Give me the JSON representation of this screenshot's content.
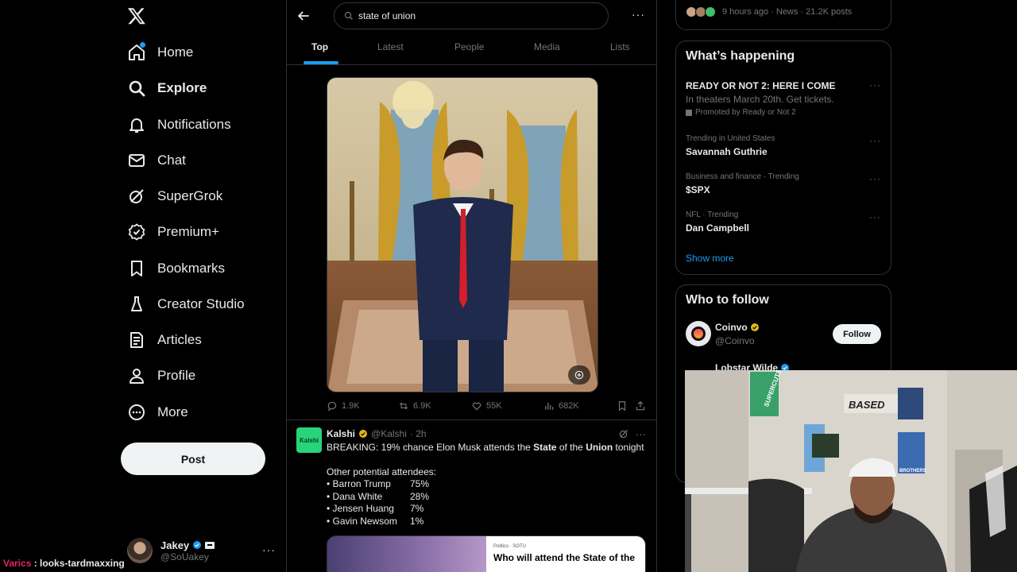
{
  "nav": {
    "items": [
      {
        "label": "Home",
        "icon": "home-icon"
      },
      {
        "label": "Explore",
        "icon": "search-icon"
      },
      {
        "label": "Notifications",
        "icon": "bell-icon"
      },
      {
        "label": "Chat",
        "icon": "mail-icon"
      },
      {
        "label": "SuperGrok",
        "icon": "grok-icon"
      },
      {
        "label": "Premium+",
        "icon": "premium-icon"
      },
      {
        "label": "Bookmarks",
        "icon": "bookmark-icon"
      },
      {
        "label": "Creator Studio",
        "icon": "creator-icon"
      },
      {
        "label": "Articles",
        "icon": "articles-icon"
      },
      {
        "label": "Profile",
        "icon": "profile-icon"
      },
      {
        "label": "More",
        "icon": "more-circle-icon"
      }
    ],
    "post_label": "Post"
  },
  "account": {
    "name": "Jakey",
    "handle": "@SoUakey",
    "more": "···"
  },
  "overlay_chat": {
    "user": "Varics",
    "separator": " : ",
    "message": "looks-tardmaxxing"
  },
  "search": {
    "query": "state of union",
    "more": "···"
  },
  "tabs": [
    "Top",
    "Latest",
    "People",
    "Media",
    "Lists"
  ],
  "tweet1": {
    "replies": "1.9K",
    "reposts": "6.9K",
    "likes": "55K",
    "views": "682K"
  },
  "tweet2": {
    "avatar_text": "Kalshi",
    "name": "Kalshi",
    "handle": "@Kalshi",
    "time": "· 2h",
    "line1_pre": "BREAKING: 19% chance Elon Musk attends the ",
    "line1_b1": "State",
    "line1_mid1": " of the ",
    "line1_b2": "Union",
    "line1_post": " tonight",
    "subhead": "Other potential attendees:",
    "attendees": [
      {
        "name": "• Barron Trump",
        "pct": "75%"
      },
      {
        "name": "• Dana White",
        "pct": "28%"
      },
      {
        "name": "• Jensen Huang",
        "pct": "7%"
      },
      {
        "name": "• Gavin Newsom",
        "pct": "1%"
      }
    ],
    "card_tag": "Politics · SOTU",
    "card_title": "Who will attend the State of the"
  },
  "right": {
    "news_meta": "9 hours ago · News · 21.2K posts",
    "happening_title": "What’s happening",
    "promo": {
      "title": "READY OR NOT 2: HERE I COME",
      "sub": "In theaters March 20th. Get tickets.",
      "tag": "Promoted by Ready or Not 2"
    },
    "trends": [
      {
        "context": "Trending in United States",
        "name": "Savannah Guthrie"
      },
      {
        "context": "Business and finance · Trending",
        "name": "$SPX"
      },
      {
        "context": "NFL · Trending",
        "name": "Dan Campbell"
      }
    ],
    "show_more": "Show more",
    "who_title": "Who to follow",
    "follow": [
      {
        "name": "Coinvo",
        "handle": "@Coinvo",
        "button": "Follow"
      },
      {
        "name": "Lobstar Wilde"
      }
    ]
  },
  "webcam": {
    "sign": "BASED",
    "poster1": "SUPERCUTS",
    "poster2": "BROTHERS"
  },
  "colors": {
    "accent": "#1d9bf0",
    "kalshi": "#28d47a",
    "background": "#000000",
    "border": "#2f3336"
  }
}
